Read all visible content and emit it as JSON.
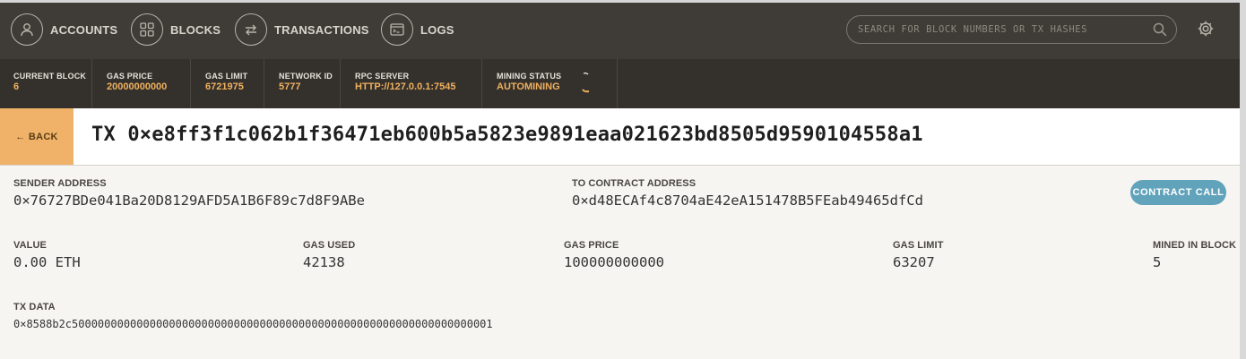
{
  "nav": {
    "items": [
      {
        "label": "ACCOUNTS",
        "icon": "person-icon"
      },
      {
        "label": "BLOCKS",
        "icon": "grid-icon"
      },
      {
        "label": "TRANSACTIONS",
        "icon": "swap-arrows-icon"
      },
      {
        "label": "LOGS",
        "icon": "terminal-icon"
      }
    ],
    "search_placeholder": "SEARCH FOR BLOCK NUMBERS OR TX HASHES"
  },
  "stats": {
    "current_block": {
      "label": "CURRENT BLOCK",
      "value": "6"
    },
    "gas_price": {
      "label": "GAS PRICE",
      "value": "20000000000"
    },
    "gas_limit": {
      "label": "GAS LIMIT",
      "value": "6721975"
    },
    "network_id": {
      "label": "NETWORK ID",
      "value": "5777"
    },
    "rpc_server": {
      "label": "RPC SERVER",
      "value": "HTTP://127.0.0.1:7545"
    },
    "mining_status": {
      "label": "MINING STATUS",
      "value": "AUTOMINING"
    }
  },
  "tx": {
    "back_label": "← BACK",
    "title": "TX 0×e8ff3f1c062b1f36471eb600b5a5823e9891eaa021623bd8505d9590104558a1",
    "badge": "CONTRACT CALL",
    "sender": {
      "label": "SENDER ADDRESS",
      "value": "0×76727BDe041Ba20D8129AFD5A1B6F89c7d8F9ABe"
    },
    "to_contract": {
      "label": "TO CONTRACT ADDRESS",
      "value": "0×d48ECAf4c8704aE42eA151478B5FEab49465dfCd"
    },
    "value": {
      "label": "VALUE",
      "value": "0.00 ETH"
    },
    "gas_used": {
      "label": "GAS USED",
      "value": "42138"
    },
    "gas_price": {
      "label": "GAS PRICE",
      "value": "100000000000"
    },
    "gas_limit": {
      "label": "GAS LIMIT",
      "value": "63207"
    },
    "mined_in_block": {
      "label": "MINED IN BLOCK",
      "value": "5"
    },
    "tx_data": {
      "label": "TX DATA",
      "value": "0×8588b2c50000000000000000000000000000000000000000000000000000000000000001"
    }
  },
  "colors": {
    "accent": "#f0b05e",
    "back_button": "#efb268",
    "badge": "#62a3bc",
    "nav_bg": "#3f3c37"
  }
}
